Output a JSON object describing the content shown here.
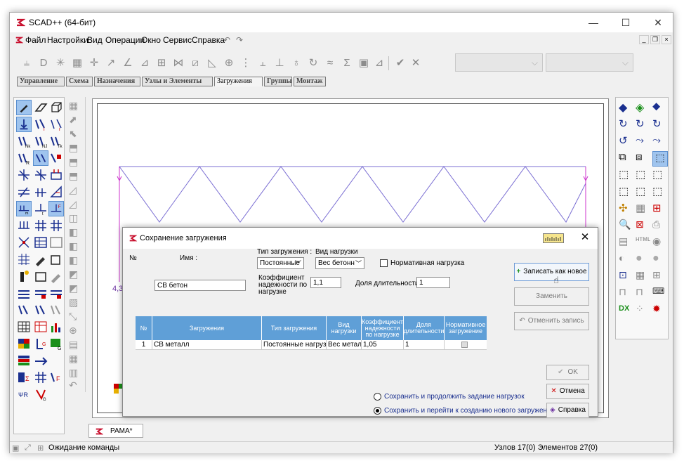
{
  "window": {
    "title": "SCAD++ (64-бит)",
    "minimize": "—",
    "maximize": "☐",
    "close": "✕"
  },
  "menu": [
    "Файл",
    "Настройки",
    "Вид",
    "Операции",
    "Окно",
    "Сервис",
    "Справка"
  ],
  "tabs": [
    "Управление",
    "Схема",
    "Назначения",
    "Узлы и Элементы",
    "Загружения",
    "Группы",
    "Монтаж"
  ],
  "active_tab": "Загружения",
  "doc_tab": "РАМА*",
  "canvas": {
    "left_label": "4,3",
    "right_label": "32",
    "badge": "2018"
  },
  "status": {
    "message": "Ожидание команды",
    "counts": "Узлов 17(0) Элементов 27(0)"
  },
  "dialog": {
    "title": "Сохранение загружения",
    "no_label": "№",
    "name_label": "Имя :",
    "name_value": "СВ бетон",
    "type_label": "Тип загружения :",
    "type_value": "Постоянные",
    "kind_label": "Вид нагрузки",
    "kind_value": "Вес бетонн",
    "normative_label": "Нормативная нагрузка",
    "coef_label": "Коэффициент надежности по нагрузке",
    "coef_value": "1,1",
    "duration_label": "Доля длительности",
    "duration_value": "1",
    "buttons": {
      "save_new": "Записать как новое",
      "replace": "Заменить",
      "cancel_record": "Отменить запись",
      "ok": "OK",
      "cancel": "Отмена",
      "help": "Справка"
    },
    "grid": {
      "headers": [
        "№",
        "Загружения",
        "Тип загружения",
        "Вид нагрузки",
        "Коэффициент надежности по нагрузке",
        "Доля длительности",
        "Нормативное загружение"
      ],
      "rows": [
        [
          "1",
          "СВ металл",
          "Постоянные нагрузки",
          "Вес металла",
          "1,05",
          "1",
          ""
        ]
      ]
    },
    "radio_continue": "Сохранить и продолжить задание нагрузок",
    "radio_new": "Сохранить и перейти к созданию нового загружения"
  }
}
